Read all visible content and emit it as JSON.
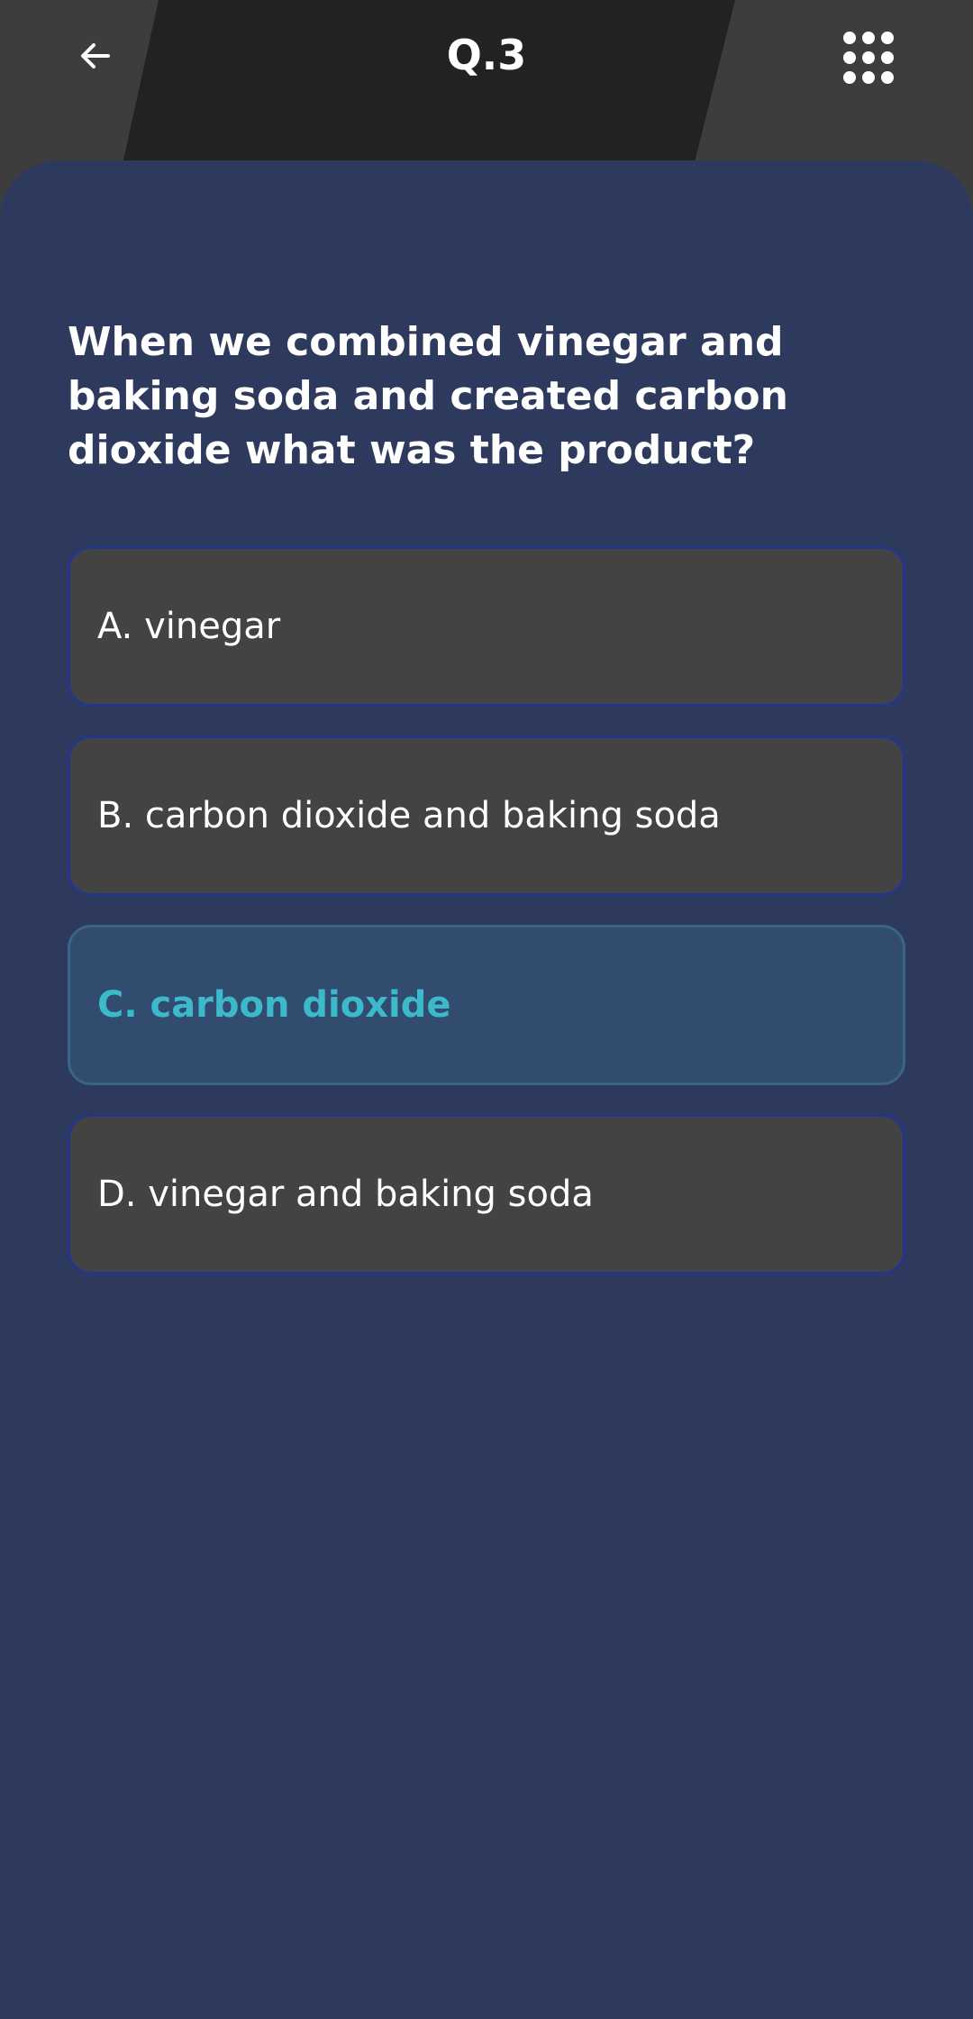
{
  "header": {
    "question_number": "Q.3",
    "back_icon": "arrow-left-icon",
    "menu_icon": "grid-dots-icon"
  },
  "question": {
    "text": "When we combined vinegar and baking soda and created carbon dioxide what was the product?"
  },
  "options": [
    {
      "label": "A. vinegar",
      "selected": false
    },
    {
      "label": "B. carbon dioxide and baking soda",
      "selected": false
    },
    {
      "label": "C. carbon dioxide",
      "selected": true
    },
    {
      "label": "D. vinegar and baking soda",
      "selected": false
    }
  ],
  "colors": {
    "header_bg": "#3d3d3d",
    "header_trapezoid": "#222222",
    "panel_bg": "#2d3a5e",
    "option_bg": "#434343",
    "option_border": "#24368a",
    "selected_bg": "#324c70",
    "selected_text": "#3cbacb"
  }
}
